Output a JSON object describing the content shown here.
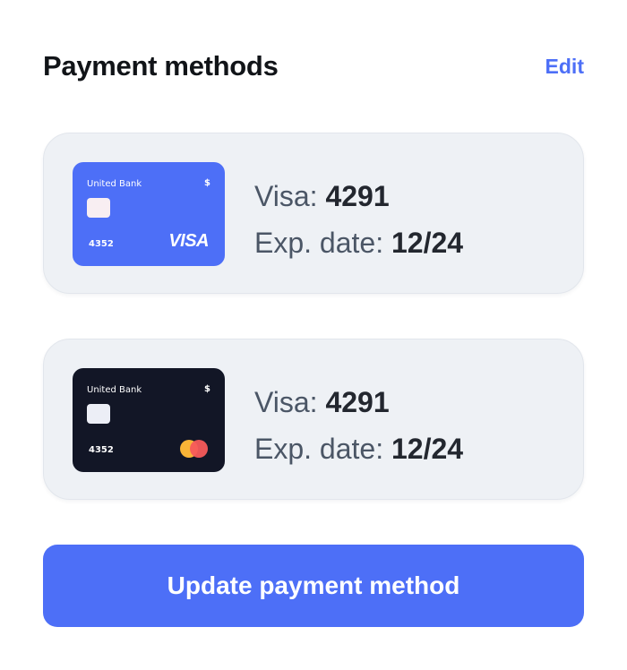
{
  "header": {
    "title": "Payment methods",
    "edit_label": "Edit"
  },
  "methods": [
    {
      "card_style": "blue",
      "bank_name": "United Bank",
      "currency_symbol": "$",
      "card_number": "4352",
      "network_logo": "visa-logo",
      "network_text": "VISA",
      "brand_label": "Visa:",
      "last_four": "4291",
      "exp_label": "Exp. date:",
      "exp_value": "12/24"
    },
    {
      "card_style": "dark",
      "bank_name": "United Bank",
      "currency_symbol": "$",
      "card_number": "4352",
      "network_logo": "mastercard-logo",
      "brand_label": "Visa:",
      "last_four": "4291",
      "exp_label": "Exp. date:",
      "exp_value": "12/24"
    }
  ],
  "actions": {
    "update_label": "Update payment method"
  },
  "colors": {
    "accent": "#4d6ff7",
    "card_blue": "#4d6ff7",
    "card_dark": "#121626",
    "panel_bg": "#eef1f5",
    "mastercard_yellow": "#f8b437",
    "mastercard_red": "#f75a5a"
  }
}
